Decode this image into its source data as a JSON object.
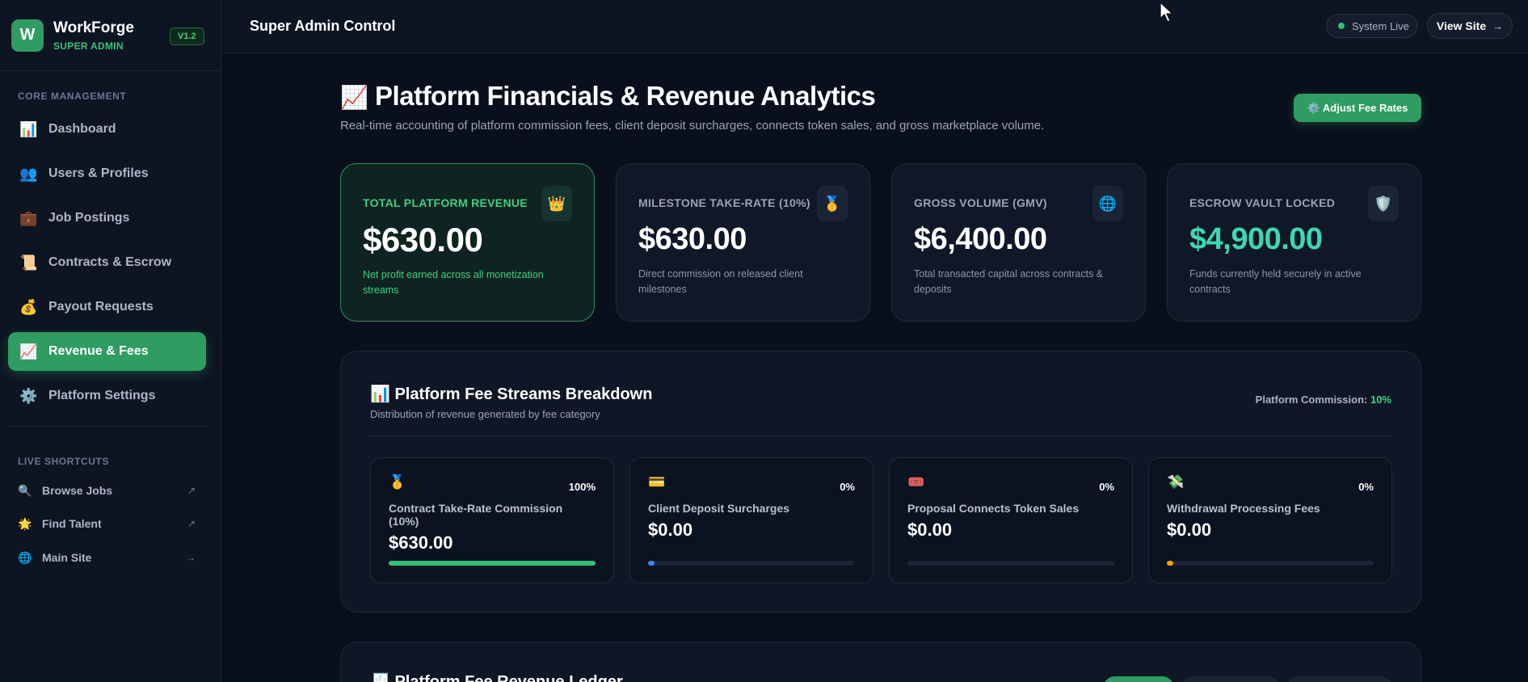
{
  "brand": {
    "logo_letter": "W",
    "name": "WorkForge",
    "role": "SUPER ADMIN",
    "version": "V1.2"
  },
  "sidebar": {
    "core_label": "CORE MANAGEMENT",
    "items": [
      {
        "icon": "📊",
        "icon_name": "bar-chart-icon",
        "label": "Dashboard"
      },
      {
        "icon": "👥",
        "icon_name": "users-icon",
        "label": "Users & Profiles"
      },
      {
        "icon": "💼",
        "icon_name": "briefcase-icon",
        "label": "Job Postings"
      },
      {
        "icon": "📜",
        "icon_name": "scroll-icon",
        "label": "Contracts & Escrow"
      },
      {
        "icon": "💰",
        "icon_name": "money-bag-icon",
        "label": "Payout Requests"
      },
      {
        "icon": "📈",
        "icon_name": "trend-up-icon",
        "label": "Revenue & Fees",
        "active": true
      },
      {
        "icon": "⚙️",
        "icon_name": "gear-icon",
        "label": "Platform Settings"
      }
    ],
    "shortcuts_label": "LIVE SHORTCUTS",
    "shortcuts": [
      {
        "icon": "🔍",
        "label": "Browse Jobs",
        "arrow": "↗"
      },
      {
        "icon": "🌟",
        "label": "Find Talent",
        "arrow": "↗"
      },
      {
        "icon": "🌐",
        "label": "Main Site",
        "arrow": "→"
      }
    ]
  },
  "topbar": {
    "title": "Super Admin Control",
    "status": "System Live",
    "view_site": "View Site",
    "view_site_arrow": "→"
  },
  "header": {
    "title_emoji": "📈",
    "title": "Platform Financials & Revenue Analytics",
    "subtitle": "Real-time accounting of platform commission fees, client deposit surcharges, connects token sales, and gross marketplace volume.",
    "adjust_button": "⚙️ Adjust Fee Rates"
  },
  "stats": [
    {
      "label": "TOTAL PLATFORM REVENUE",
      "icon": "👑",
      "value": "$630.00",
      "desc": "Net profit earned across all monetization streams"
    },
    {
      "label": "MILESTONE TAKE-RATE (10%)",
      "icon": "🥇",
      "value": "$630.00",
      "desc": "Direct commission on released client milestones"
    },
    {
      "label": "GROSS VOLUME (GMV)",
      "icon": "🌐",
      "value": "$6,400.00",
      "desc": "Total transacted capital across contracts & deposits"
    },
    {
      "label": "ESCROW VAULT LOCKED",
      "icon": "🛡️",
      "value": "$4,900.00",
      "desc": "Funds currently held securely in active contracts"
    }
  ],
  "breakdown": {
    "title": "📊 Platform Fee Streams Breakdown",
    "subtitle": "Distribution of revenue generated by fee category",
    "commission_label": "Platform Commission:",
    "commission_value": "10%",
    "streams": [
      {
        "icon": "🥇",
        "percent": "100%",
        "name": "Contract Take-Rate Commission (10%)",
        "amount": "$630.00",
        "share": 1.0,
        "color": "#35c07a"
      },
      {
        "icon": "💳",
        "percent": "0%",
        "name": "Client Deposit Surcharges",
        "amount": "$0.00",
        "share": 0.03,
        "color": "#3b82f6"
      },
      {
        "icon": "🎟️",
        "percent": "0%",
        "name": "Proposal Connects Token Sales",
        "amount": "$0.00",
        "share": 0.0,
        "color": "#a855f7"
      },
      {
        "icon": "💸",
        "percent": "0%",
        "name": "Withdrawal Processing Fees",
        "amount": "$0.00",
        "share": 0.03,
        "color": "#f59e0b"
      }
    ]
  },
  "ledger": {
    "title": "🧾 Platform Fee Revenue Ledger"
  }
}
